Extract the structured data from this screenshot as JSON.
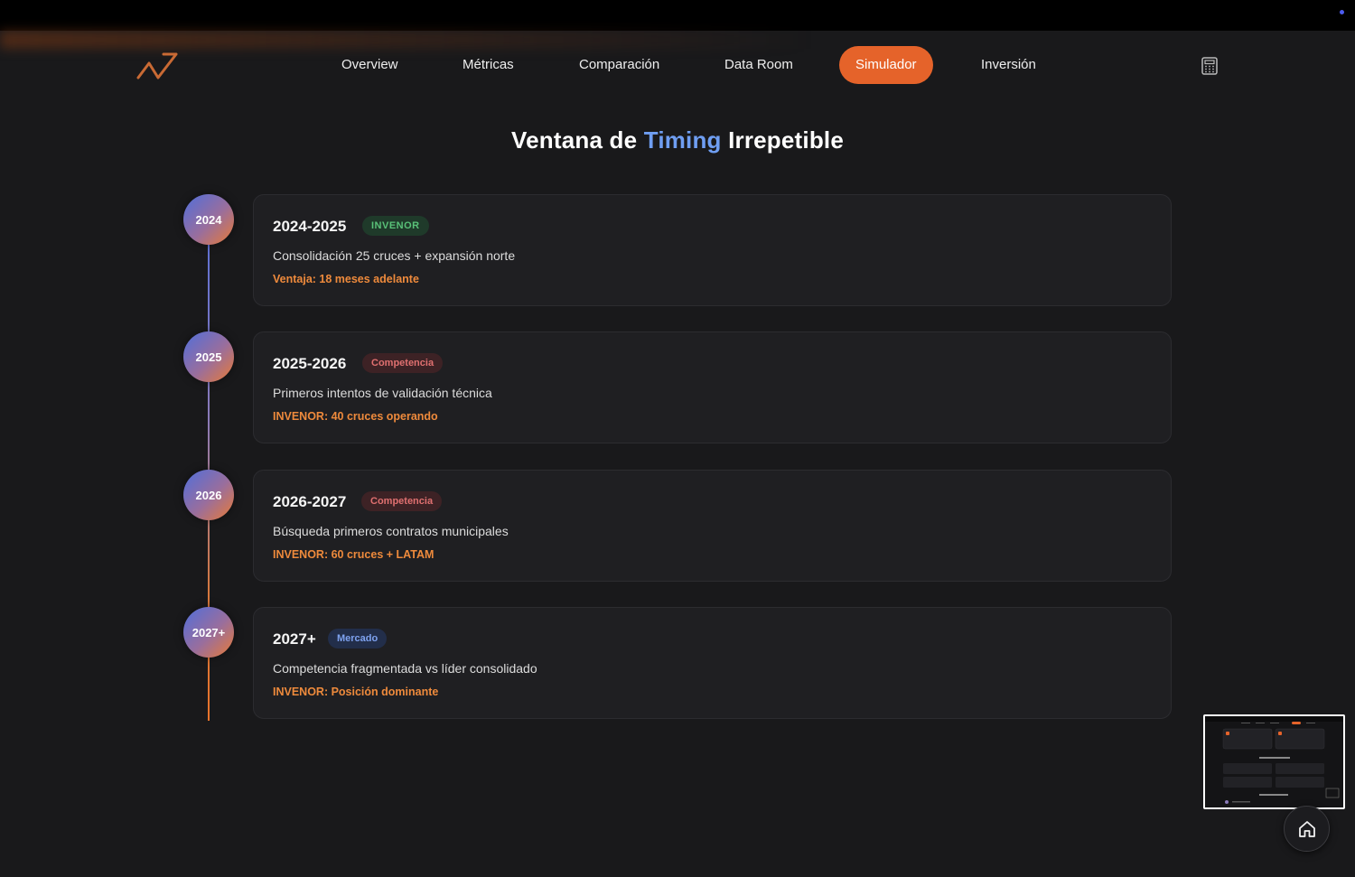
{
  "colors": {
    "accent": "#e5632a",
    "highlight_blue": "#6f9ef2",
    "advantage_orange": "#ee8a3c",
    "background": "#19191b"
  },
  "header": {
    "logo_icon": "invenor-logo-icon",
    "nav": [
      {
        "label": "Overview",
        "active": false
      },
      {
        "label": "Métricas",
        "active": false
      },
      {
        "label": "Comparación",
        "active": false
      },
      {
        "label": "Data Room",
        "active": false
      },
      {
        "label": "Simulador",
        "active": true
      },
      {
        "label": "Inversión",
        "active": false
      }
    ],
    "calculator_icon": "calculator-icon"
  },
  "main": {
    "heading": {
      "pre": "Ventana de ",
      "highlight": "Timing",
      "post": " Irrepetible"
    },
    "timeline": [
      {
        "year": "2024",
        "period": "2024-2025",
        "tag": "INVENOR",
        "tag_color": "green",
        "description": "Consolidación 25 cruces + expansión norte",
        "advantage": "Ventaja: 18 meses adelante"
      },
      {
        "year": "2025",
        "period": "2025-2026",
        "tag": "Competencia",
        "tag_color": "red",
        "description": "Primeros intentos de validación técnica",
        "advantage": "INVENOR: 40 cruces operando"
      },
      {
        "year": "2026",
        "period": "2026-2027",
        "tag": "Competencia",
        "tag_color": "red",
        "description": "Búsqueda primeros contratos municipales",
        "advantage": "INVENOR: 60 cruces + LATAM"
      },
      {
        "year": "2027+",
        "period": "2027+",
        "tag": "Mercado",
        "tag_color": "blue",
        "description": "Competencia fragmentada vs líder consolidado",
        "advantage": "INVENOR: Posición dominante"
      }
    ]
  },
  "widgets": {
    "minimap": "page-thumbnail",
    "home_icon": "home-icon"
  }
}
